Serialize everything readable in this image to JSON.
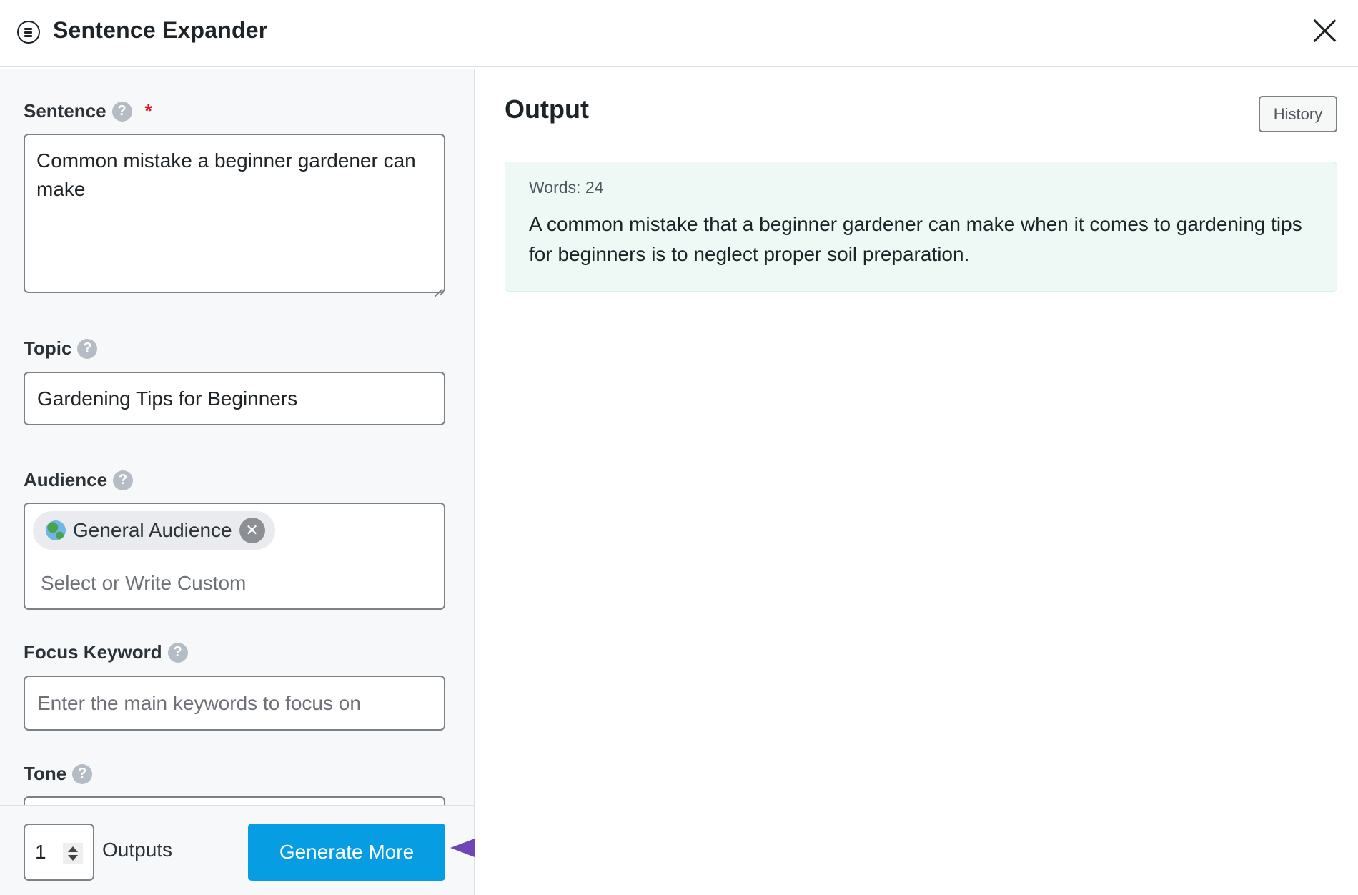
{
  "header": {
    "title": "Sentence Expander",
    "menu_icon": "menu-circle-icon",
    "close_icon": "close-icon"
  },
  "form": {
    "sentence": {
      "label": "Sentence",
      "required_mark": "*",
      "value": "Common mistake a beginner gardener can make"
    },
    "topic": {
      "label": "Topic",
      "value": "Gardening Tips for Beginners"
    },
    "audience": {
      "label": "Audience",
      "chips": [
        {
          "label": "General Audience",
          "icon": "globe-icon"
        }
      ],
      "placeholder": "Select or Write Custom"
    },
    "focus_keyword": {
      "label": "Focus Keyword",
      "value": "",
      "placeholder": "Enter the main keywords to focus on"
    },
    "tone": {
      "label": "Tone"
    },
    "help_glyph": "?"
  },
  "footer": {
    "outputs_count": "1",
    "outputs_label": "Outputs",
    "generate_label": "Generate More"
  },
  "output": {
    "title": "Output",
    "history_label": "History",
    "results": [
      {
        "word_count": "Words: 24",
        "text": "A common mistake that a beginner gardener can make when it comes to gardening tips for beginners is to neglect proper soil preparation."
      }
    ]
  },
  "annotation": {
    "arrow_color": "#6f45b8"
  },
  "colors": {
    "accent": "#069de3",
    "required": "#e0121e",
    "output_bg": "#eef8f4"
  }
}
